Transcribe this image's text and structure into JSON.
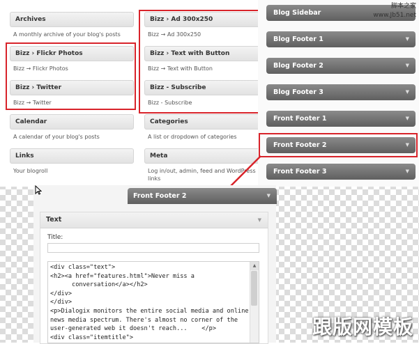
{
  "available_widgets": [
    {
      "title": "Archives",
      "desc": "A monthly archive of your blog's posts"
    },
    {
      "title": "Bizz   › Ad 300x250",
      "desc": "Bizz → Ad 300x250"
    },
    {
      "title": "Bizz   › Flickr Photos",
      "desc": "Bizz → Flickr Photos"
    },
    {
      "title": "Bizz   › Text with Button",
      "desc": "Bizz → Text with Button"
    },
    {
      "title": "Bizz   › Twitter",
      "desc": "Bizz → Twitter"
    },
    {
      "title": "Bizz - Subscribe",
      "desc": "Bizz - Subscribe"
    },
    {
      "title": "Calendar",
      "desc": "A calendar of your blog's posts"
    },
    {
      "title": "Categories",
      "desc": "A list or dropdown of categories"
    },
    {
      "title": "Links",
      "desc": "Your blogroll"
    },
    {
      "title": "Meta",
      "desc": "Log in/out, admin, feed and WordPress links"
    }
  ],
  "widget_areas": [
    "Blog Sidebar",
    "Blog Footer 1",
    "Blog Footer 2",
    "Blog Footer 3",
    "Front Footer 1",
    "Front Footer 2",
    "Front Footer 3"
  ],
  "expanded_area": {
    "title": "Front Footer 2",
    "widget": {
      "title": "Text",
      "title_label": "Title:",
      "title_value": "",
      "content": "<div class=\"text\">\n<h2><a href=\"features.html\">Never miss a\n      conversation</a></h2>\n</div>\n</div>\n<p>Dialogix monitors the entire social media and online\nnews media spectrum. There's almost no corner of the\nuser-generated web it doesn't reach...    </p>\n<div class=\"itemtitle\">"
    }
  },
  "watermarks": {
    "top_line1": "脚本之家",
    "top_line2": "www.Jb51.net",
    "bottom": "跟版网模板"
  },
  "icons": {
    "arrow": "triangle-down-icon",
    "cursor": "mouse-cursor-icon"
  },
  "colors": {
    "highlight": "#d8232a",
    "area_bar": "#6e6e6e"
  }
}
